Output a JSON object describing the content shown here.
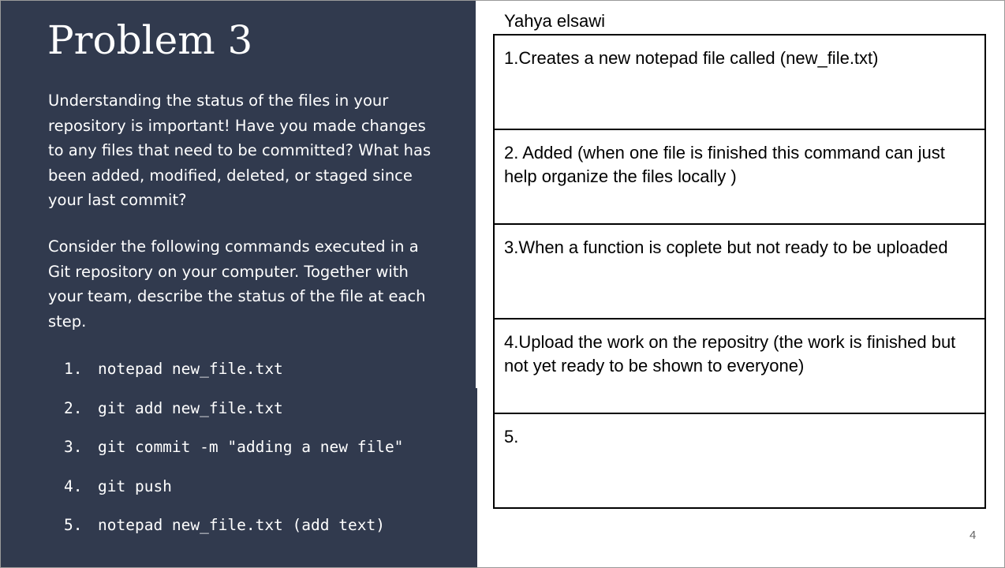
{
  "left_panel": {
    "title": "Problem 3",
    "paragraph1": "Understanding the status of the files in your repository is important! Have you made changes to any files that need to be committed? What has been added, modified, deleted, or staged since your last commit?",
    "paragraph2": "Consider the following commands executed in a Git repository on your computer. Together with your team, describe the status of the file at each step.",
    "commands": [
      {
        "num": "1.",
        "text": "notepad new_file.txt"
      },
      {
        "num": "2.",
        "text": "git add new_file.txt"
      },
      {
        "num": "3.",
        "text": "git commit -m \"adding a new file\""
      },
      {
        "num": "4.",
        "text": "git push"
      },
      {
        "num": "5.",
        "text": "notepad new_file.txt (add text)"
      }
    ]
  },
  "right_panel": {
    "author": "Yahya elsawi",
    "answers": [
      "1.Creates a new notepad file called (new_file.txt)",
      "2. Added (when one file is finished this command can just help organize the files locally )",
      "3.When a function is coplete but not ready to be uploaded",
      "4.Upload the work on the repositry (the work is finished but not yet ready to be shown to everyone)",
      "5."
    ]
  },
  "page_number": "4",
  "colors": {
    "panel_background": "#313a4e",
    "panel_text": "#ffffff",
    "table_border": "#000000",
    "page_number": "#666666"
  }
}
